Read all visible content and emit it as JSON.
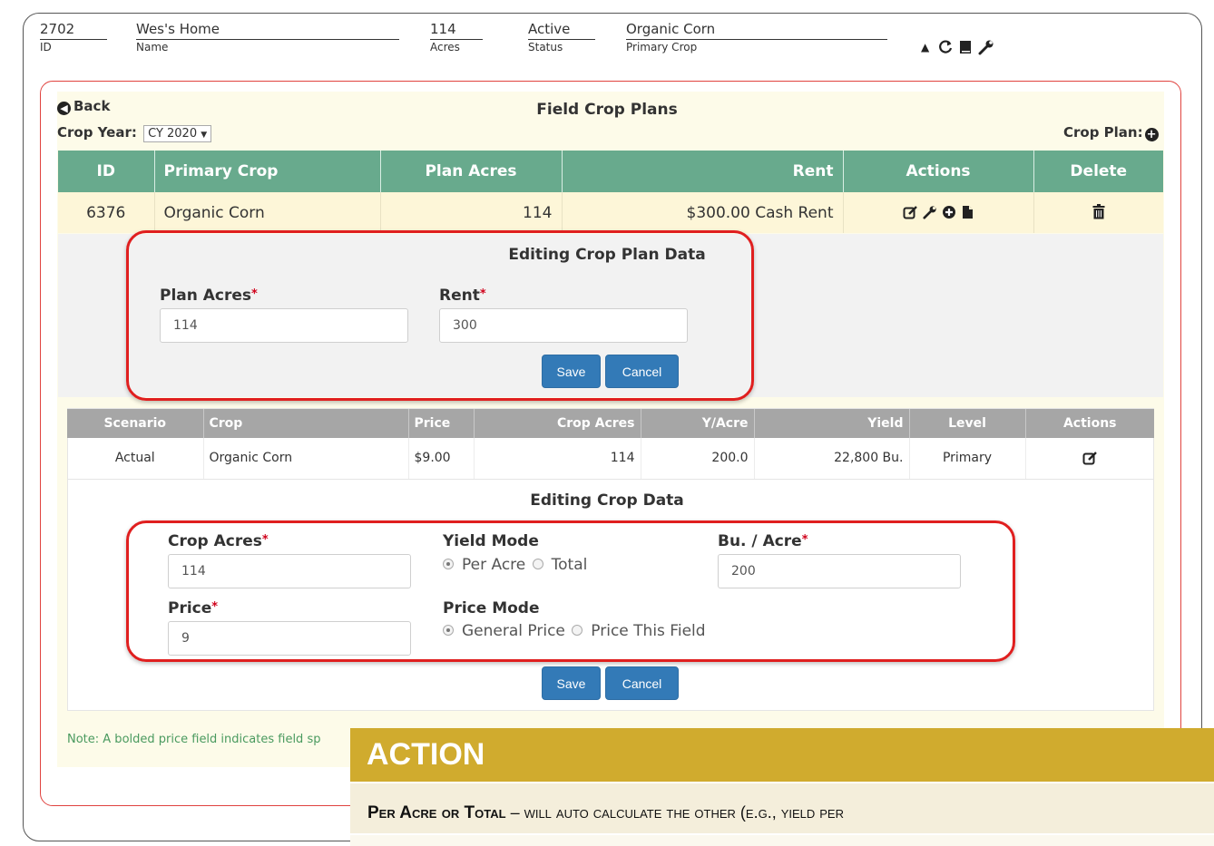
{
  "header": {
    "id_value": "2702",
    "id_label": "ID",
    "name_value": "Wes's Home",
    "name_label": "Name",
    "acres_value": "114",
    "acres_label": "Acres",
    "status_value": "Active",
    "status_label": "Status",
    "crop_value": "Organic Corn",
    "crop_label": "Primary Crop",
    "icons": [
      "caret-up-icon",
      "refresh-icon",
      "book-icon",
      "wrench-icon"
    ]
  },
  "nav": {
    "back_label": "Back",
    "page_title": "Field Crop Plans",
    "crop_year_label": "Crop Year:",
    "crop_year_value": "CY 2020",
    "crop_plan_label": "Crop Plan:"
  },
  "plans_table": {
    "headers": [
      "ID",
      "Primary Crop",
      "Plan Acres",
      "Rent",
      "Actions",
      "Delete"
    ],
    "rows": [
      {
        "id": "6376",
        "crop": "Organic Corn",
        "acres": "114",
        "rent": "$300.00 Cash Rent"
      }
    ]
  },
  "plan_edit": {
    "title": "Editing Crop Plan Data",
    "plan_acres_label": "Plan Acres",
    "plan_acres_value": "114",
    "rent_label": "Rent",
    "rent_value": "300",
    "save_label": "Save",
    "cancel_label": "Cancel"
  },
  "crop_table": {
    "headers": [
      "Scenario",
      "Crop",
      "Price",
      "Crop Acres",
      "Y/Acre",
      "Yield",
      "Level",
      "Actions"
    ],
    "rows": [
      {
        "scenario": "Actual",
        "crop": "Organic Corn",
        "price": "$9.00",
        "acres": "114",
        "yacre": "200.0",
        "yield": "22,800 Bu.",
        "level": "Primary"
      }
    ]
  },
  "crop_edit": {
    "title": "Editing Crop Data",
    "crop_acres_label": "Crop Acres",
    "crop_acres_value": "114",
    "price_label": "Price",
    "price_value": "9",
    "yield_mode_label": "Yield Mode",
    "yield_mode_options": [
      "Per Acre",
      "Total"
    ],
    "yield_mode_selected": "Per Acre",
    "price_mode_label": "Price Mode",
    "price_mode_options": [
      "General Price",
      "Price This Field"
    ],
    "price_mode_selected": "General Price",
    "bu_acre_label": "Bu. / Acre",
    "bu_acre_value": "200",
    "save_label": "Save",
    "cancel_label": "Cancel"
  },
  "note": "Note: A bolded price field indicates field sp",
  "overlay": {
    "heading": "ACTION",
    "term": "Per Acre or Total",
    "description": " – will auto calculate the other (e.g., yield per"
  },
  "colors": {
    "table_header": "#68aa8d",
    "sub_header": "#a6a6a6",
    "button": "#337ab7",
    "highlight": "#e01f1f",
    "overlay_header": "#d0ab2e"
  }
}
